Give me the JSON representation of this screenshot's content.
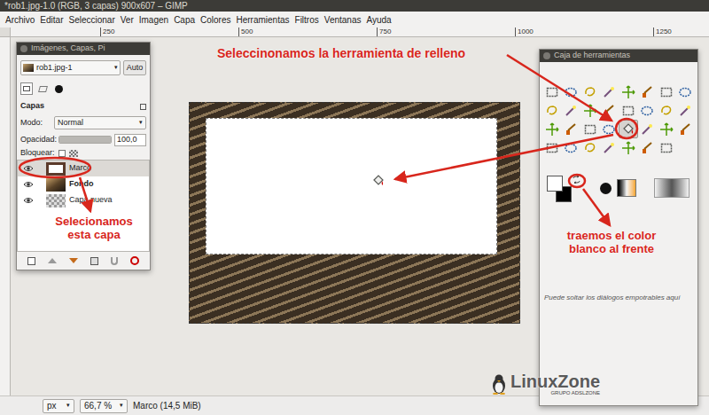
{
  "window": {
    "title": "*rob1.jpg-1.0 (RGB, 3 capas) 900x607 – GIMP"
  },
  "menu": [
    "Archivo",
    "Editar",
    "Seleccionar",
    "Ver",
    "Imagen",
    "Capa",
    "Colores",
    "Herramientas",
    "Filtros",
    "Ventanas",
    "Ayuda"
  ],
  "ruler": [
    "250",
    "500",
    "750",
    "1000",
    "1250"
  ],
  "layers_dialog": {
    "title": "Imágenes, Capas, Pi",
    "image": "rob1.jpg-1",
    "auto_button": "Auto",
    "section": "Capas",
    "mode_label": "Modo:",
    "mode": "Normal",
    "opacity_label": "Opacidad:",
    "opacity": "100,0",
    "opacity_level": 1,
    "lock_label": "Bloquear:",
    "layers": [
      {
        "name": "Marco",
        "visible": true,
        "selected": true,
        "bold": false,
        "kind": "frame"
      },
      {
        "name": "Fondo",
        "visible": true,
        "selected": false,
        "bold": true,
        "kind": "photo"
      },
      {
        "name": "Capa nueva",
        "visible": true,
        "selected": false,
        "bold": false,
        "kind": "transparent"
      }
    ]
  },
  "toolbox": {
    "title": "Caja de herramientas",
    "tools": [
      {
        "selected": false
      },
      {
        "selected": false
      },
      {
        "selected": false
      },
      {
        "selected": false
      },
      {
        "selected": false
      },
      {
        "selected": false
      },
      {
        "selected": false
      },
      {
        "selected": false
      },
      {
        "selected": false
      },
      {
        "selected": false
      },
      {
        "selected": false
      },
      {
        "selected": false
      },
      {
        "selected": false
      },
      {
        "selected": false
      },
      {
        "selected": false
      },
      {
        "selected": false
      },
      {
        "selected": false
      },
      {
        "selected": false
      },
      {
        "selected": false
      },
      {
        "selected": false
      },
      {
        "selected": true
      },
      {
        "selected": false
      },
      {
        "selected": false
      },
      {
        "selected": false
      },
      {
        "selected": false
      },
      {
        "selected": false
      },
      {
        "selected": false
      },
      {
        "selected": false
      },
      {
        "selected": false
      },
      {
        "selected": false
      },
      {
        "selected": false
      }
    ],
    "foreground": "#ffffff",
    "background": "#000000",
    "drop_hint": "Puede soltar los diálogos empotrables aquí"
  },
  "annotations": [
    {
      "text": "Seleccinonamos la herramienta de relleno"
    },
    {
      "text": "Selecionamos esta capa"
    },
    {
      "text": "traemos el color blanco al frente"
    }
  ],
  "status_bar": {
    "unit": "px",
    "zoom": "66,7 %",
    "info": "Marco (14,5 MiB)"
  },
  "watermark": {
    "name": "LinuxZone",
    "subtitle": "GRUPO ADSLZONE"
  }
}
